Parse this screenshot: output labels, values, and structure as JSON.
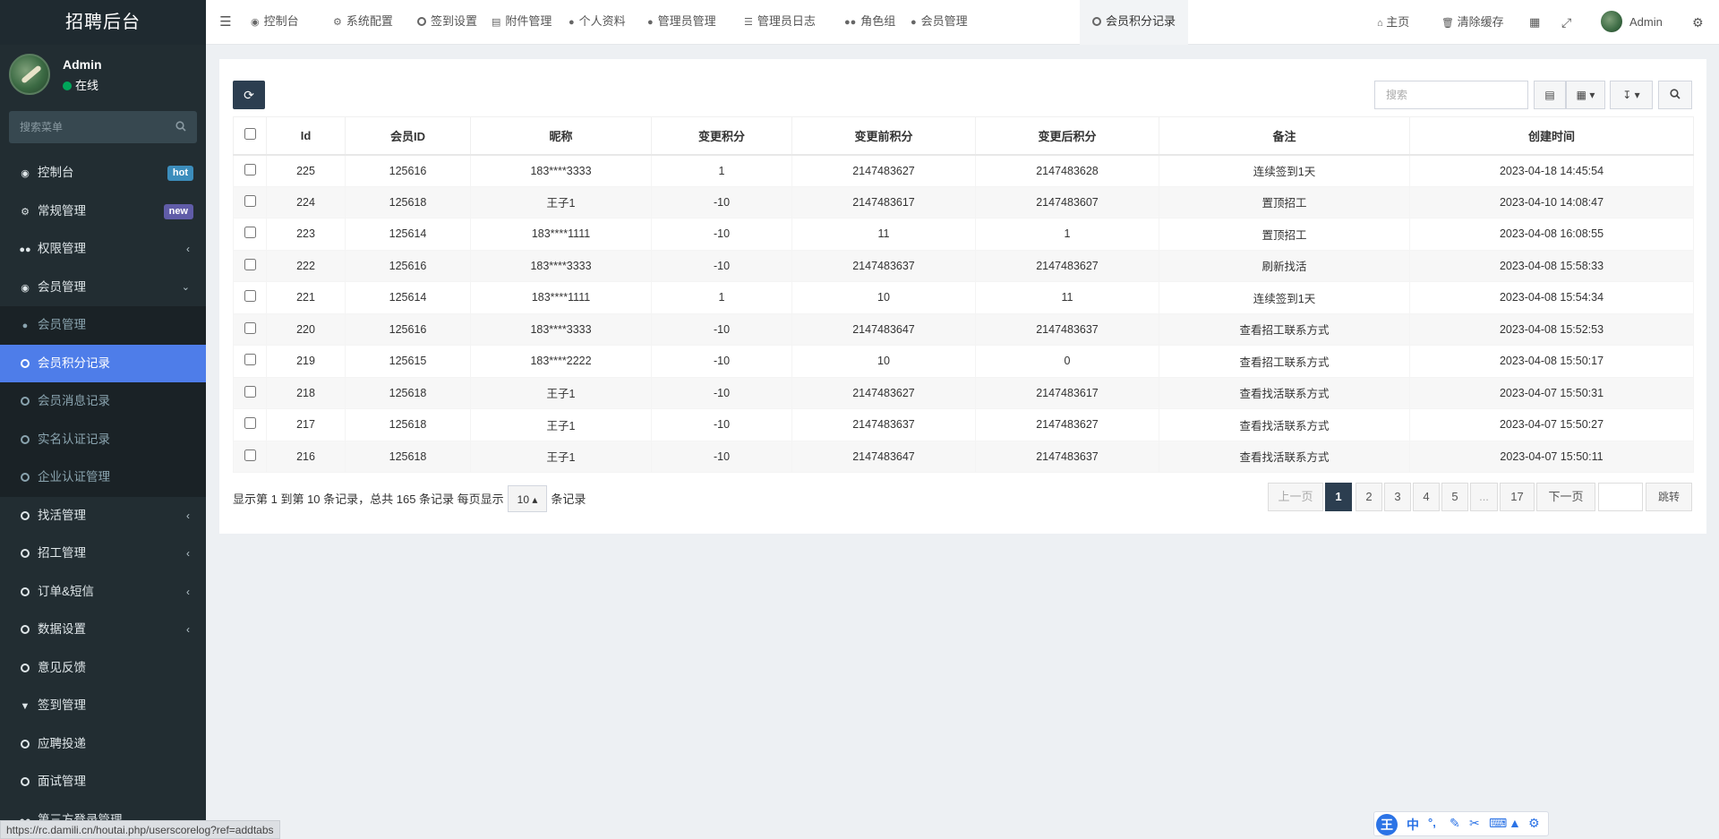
{
  "sidebar": {
    "logo": "招聘后台",
    "user_name": "Admin",
    "user_status": "在线",
    "search_placeholder": "搜索菜单",
    "items": [
      {
        "label": "控制台",
        "icon": "dashboard-icon",
        "badge": "hot"
      },
      {
        "label": "常规管理",
        "icon": "cogs-icon",
        "badge": "new"
      },
      {
        "label": "权限管理",
        "icon": "group-icon",
        "caret": "left"
      },
      {
        "label": "会员管理",
        "icon": "user-circle-icon",
        "caret": "down"
      },
      {
        "label": "会员管理",
        "icon": "user-icon",
        "sub": true
      },
      {
        "label": "会员积分记录",
        "icon": "circle-icon",
        "sub": true,
        "active": true
      },
      {
        "label": "会员消息记录",
        "icon": "circle-icon",
        "sub": true
      },
      {
        "label": "实名认证记录",
        "icon": "circle-icon",
        "sub": true
      },
      {
        "label": "企业认证管理",
        "icon": "circle-icon",
        "sub": true
      },
      {
        "label": "找活管理",
        "icon": "circle-icon",
        "caret": "left"
      },
      {
        "label": "招工管理",
        "icon": "circle-icon",
        "caret": "left"
      },
      {
        "label": "订单&短信",
        "icon": "circle-icon",
        "caret": "left"
      },
      {
        "label": "数据设置",
        "icon": "circle-icon",
        "caret": "left"
      },
      {
        "label": "意见反馈",
        "icon": "circle-icon"
      },
      {
        "label": "签到管理",
        "icon": "map-marker-icon"
      },
      {
        "label": "应聘投递",
        "icon": "circle-icon"
      },
      {
        "label": "面试管理",
        "icon": "circle-icon"
      },
      {
        "label": "第三方登录管理",
        "icon": "group-icon"
      }
    ]
  },
  "navbar": {
    "tabs": [
      {
        "label": "控制台",
        "icon": "dashboard-icon"
      },
      {
        "label": "系统配置",
        "icon": "cog-icon"
      },
      {
        "label": "签到设置",
        "icon": "circle-icon"
      },
      {
        "label": "附件管理",
        "icon": "file-image-icon"
      },
      {
        "label": "个人资料",
        "icon": "user-icon"
      },
      {
        "label": "管理员管理",
        "icon": "user-icon"
      },
      {
        "label": "管理员日志",
        "icon": "list-alt-icon"
      },
      {
        "label": "角色组",
        "icon": "group-icon"
      },
      {
        "label": "会员管理",
        "icon": "user-icon"
      },
      {
        "label": "会员积分记录",
        "icon": "circle-icon",
        "active": true
      }
    ],
    "home": "主页",
    "clear_cache": "清除缓存",
    "admin": "Admin"
  },
  "toolbar": {
    "search_placeholder": "搜索"
  },
  "table": {
    "columns": [
      "Id",
      "会员ID",
      "昵称",
      "变更积分",
      "变更前积分",
      "变更后积分",
      "备注",
      "创建时间"
    ],
    "rows": [
      [
        "225",
        "125616",
        "183****3333",
        "1",
        "2147483627",
        "2147483628",
        "连续签到1天",
        "2023-04-18 14:45:54"
      ],
      [
        "224",
        "125618",
        "王子1",
        "-10",
        "2147483617",
        "2147483607",
        "置顶招工",
        "2023-04-10 14:08:47"
      ],
      [
        "223",
        "125614",
        "183****1111",
        "-10",
        "11",
        "1",
        "置顶招工",
        "2023-04-08 16:08:55"
      ],
      [
        "222",
        "125616",
        "183****3333",
        "-10",
        "2147483637",
        "2147483627",
        "刷新找活",
        "2023-04-08 15:58:33"
      ],
      [
        "221",
        "125614",
        "183****1111",
        "1",
        "10",
        "11",
        "连续签到1天",
        "2023-04-08 15:54:34"
      ],
      [
        "220",
        "125616",
        "183****3333",
        "-10",
        "2147483647",
        "2147483637",
        "查看招工联系方式",
        "2023-04-08 15:52:53"
      ],
      [
        "219",
        "125615",
        "183****2222",
        "-10",
        "10",
        "0",
        "查看招工联系方式",
        "2023-04-08 15:50:17"
      ],
      [
        "218",
        "125618",
        "王子1",
        "-10",
        "2147483627",
        "2147483617",
        "查看找活联系方式",
        "2023-04-07 15:50:31"
      ],
      [
        "217",
        "125618",
        "王子1",
        "-10",
        "2147483637",
        "2147483627",
        "查看找活联系方式",
        "2023-04-07 15:50:27"
      ],
      [
        "216",
        "125618",
        "王子1",
        "-10",
        "2147483647",
        "2147483637",
        "查看找活联系方式",
        "2023-04-07 15:50:11"
      ]
    ]
  },
  "pagination": {
    "info": "显示第 1 到第 10 条记录，总共 165 条记录 每页显示",
    "page_size": "10",
    "suffix": "条记录",
    "prev": "上一页",
    "pages": [
      "1",
      "2",
      "3",
      "4",
      "5",
      "...",
      "17"
    ],
    "current": "1",
    "next": "下一页",
    "jump": "跳转"
  },
  "status_bar": {
    "url": "https://rc.damili.cn/houtai.php/userscorelog?ref=addtabs"
  },
  "ime": {
    "logo": "王",
    "lang": "中"
  },
  "colors": {
    "sidebar_bg": "#222d32",
    "active_menu": "#4e7de9",
    "primary_button": "#2c3e50",
    "hot_badge": "#3c8dbc",
    "new_badge": "#605ca8",
    "online": "#00a65a"
  }
}
